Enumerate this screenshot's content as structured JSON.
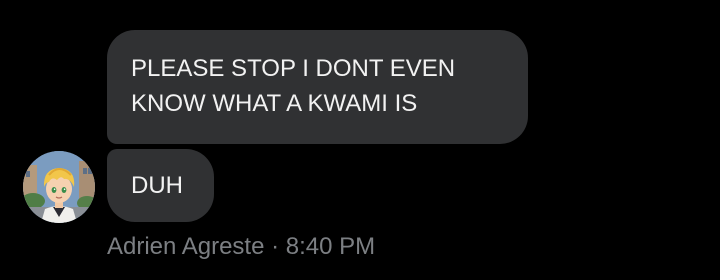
{
  "messages": [
    {
      "line1": "PLEASE STOP I DONT EVEN",
      "line2": "KNOW WHAT A KWAMI IS"
    },
    {
      "text": "DUH"
    }
  ],
  "sender": {
    "name": "Adrien Agreste",
    "separator": " · ",
    "time": "8:40 PM",
    "avatar_icon": "profile-avatar-blond-cartoon-character"
  },
  "colors": {
    "background": "#000000",
    "bubble": "#303133",
    "bubble_text": "#f2f2f2",
    "meta_text": "#7c7f83"
  }
}
